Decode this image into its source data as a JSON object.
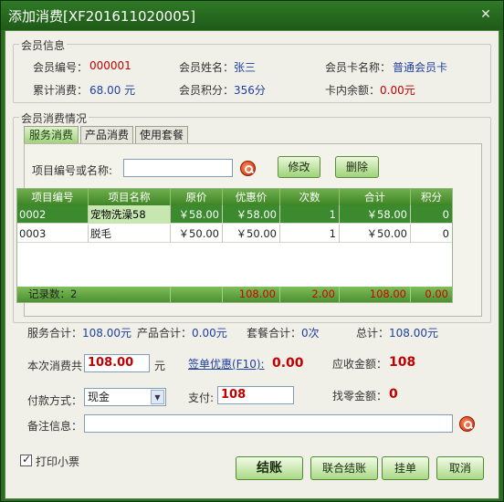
{
  "window": {
    "title": "添加消费[XF201611020005]",
    "close": "✕"
  },
  "member": {
    "legend": "会员信息",
    "no_label": "会员编号：",
    "no": "000001",
    "name_label": "会员姓名：",
    "name": "张三",
    "card_label": "会员卡名称：",
    "card": "普通会员卡",
    "total_label": "累计消费：",
    "total": "68.00 元",
    "points_label": "会员积分：",
    "points": "356分",
    "balance_label": "卡内余额：",
    "balance": "0.00元"
  },
  "consume": {
    "legend": "会员消费情况",
    "tabs": [
      "服务消费",
      "产品消费",
      "使用套餐"
    ],
    "search_label": "项目编号或名称:",
    "search_value": "",
    "edit_btn": "修改",
    "delete_btn": "删除",
    "columns": [
      "项目编号",
      "项目名称",
      "原价",
      "优惠价",
      "次数",
      "合计",
      "积分"
    ],
    "rows": [
      {
        "code": "0002",
        "name": "宠物洗澡58",
        "orig": "￥58.00",
        "disc": "￥58.00",
        "count": "1",
        "sum": "￥58.00",
        "points": "0"
      },
      {
        "code": "0003",
        "name": "脱毛",
        "orig": "￥50.00",
        "disc": "￥50.00",
        "count": "1",
        "sum": "￥50.00",
        "points": "0"
      }
    ],
    "footer": {
      "records": "记录数：2",
      "orig": "108.00",
      "count": "2.00",
      "sum": "108.00",
      "points": "0.00"
    }
  },
  "summary": {
    "service_label": "服务合计：",
    "service": "108.00元",
    "product_label": "产品合计：",
    "product": "0.00元",
    "package_label": "套餐合计：",
    "package": "0次",
    "total_label": "总计：",
    "total": "108.00元"
  },
  "payment": {
    "this_label": "本次消费共",
    "this_value": "108.00",
    "unit": "元",
    "discount_link": "签单优惠(F10):",
    "discount_value": "0.00",
    "receivable_label": "应收金额：",
    "receivable": "108",
    "method_label": "付款方式：",
    "method": "现金",
    "pay_label": "支付:",
    "pay": "108",
    "change_label": "找零金额：",
    "change": "0",
    "remark_label": "备注信息：",
    "remark": ""
  },
  "footer": {
    "print_label": "打印小票",
    "checkout": "结账",
    "joint": "联合结账",
    "hold": "挂单",
    "cancel": "取消"
  }
}
